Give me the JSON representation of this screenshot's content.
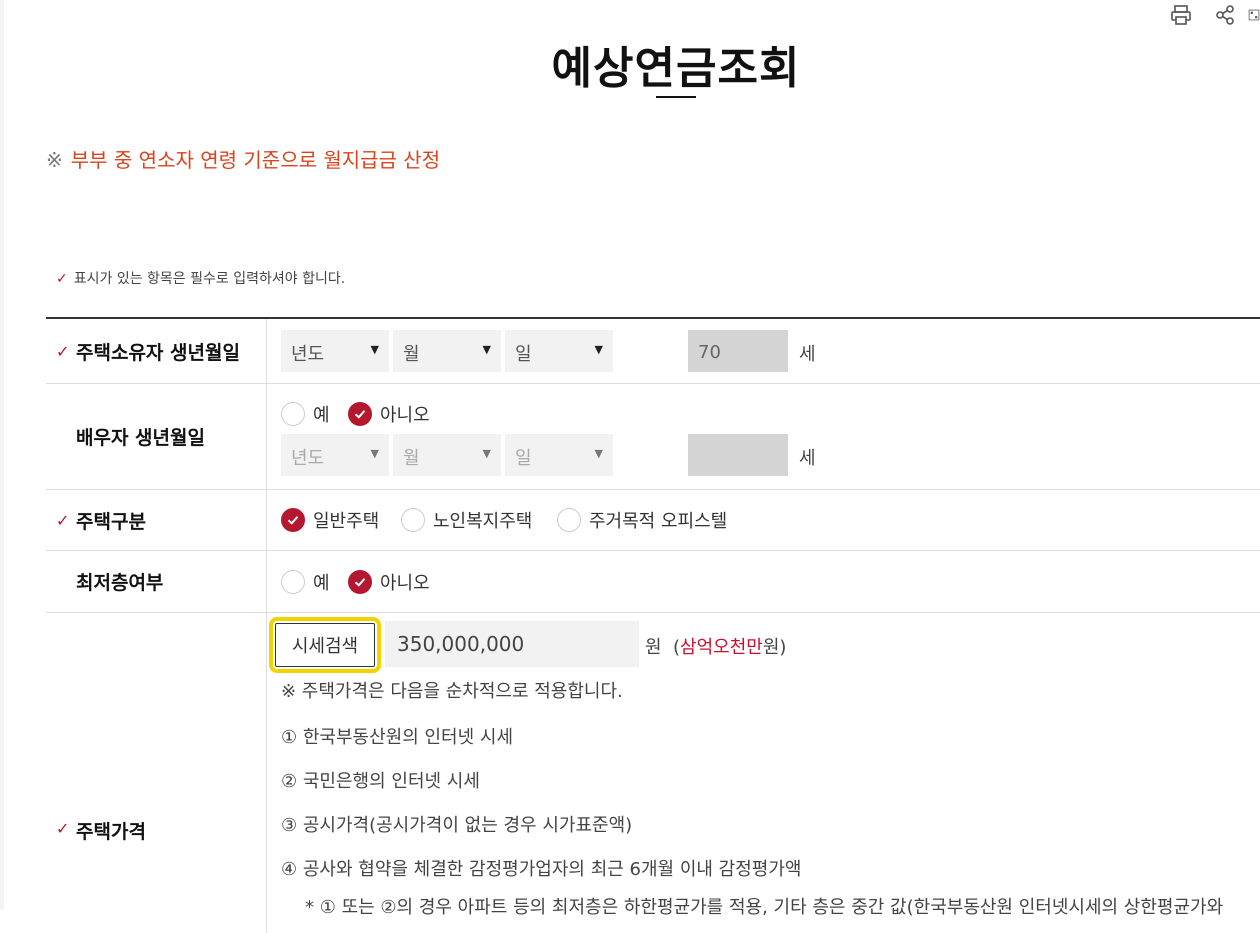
{
  "page": {
    "title": "예상연금조회",
    "notice_mark": "※",
    "notice_text": "부부 중 연소자 연령 기준으로 월지급금 산정",
    "required_text": "표시가 있는 항목은 필수로 입력하셔야 합니다."
  },
  "toolbar": {
    "print_icon": "printer-icon",
    "share_icon": "share-icon",
    "third_icon": "qr-icon"
  },
  "owner_birth": {
    "label": "주택소유자 생년월일",
    "year": "년도",
    "month": "월",
    "day": "일",
    "age": "70",
    "age_unit": "세"
  },
  "spouse_birth": {
    "label": "배우자 생년월일",
    "yes": "예",
    "no": "아니오",
    "selected": "아니오",
    "year": "년도",
    "month": "월",
    "day": "일",
    "age": "",
    "age_unit": "세"
  },
  "house_type": {
    "label": "주택구분",
    "options": [
      "일반주택",
      "노인복지주택",
      "주거목적 오피스텔"
    ],
    "selected": "일반주택"
  },
  "lowest_floor": {
    "label": "최저층여부",
    "yes": "예",
    "no": "아니오",
    "selected": "아니오"
  },
  "house_price": {
    "label": "주택가격",
    "search_button": "시세검색",
    "value": "350,000,000",
    "unit": "원",
    "korean_prefix": "(",
    "korean_amount": "삼억오천만",
    "korean_suffix": "원)",
    "note": "※ 주택가격은 다음을 순차적으로 적용합니다.",
    "rules": [
      "① 한국부동산원의 인터넷 시세",
      "② 국민은행의 인터넷 시세",
      "③ 공시가격(공시가격이 없는 경우 시가표준액)",
      "④ 공사와 협약을 체결한 감정평가업자의 최근 6개월 이내 감정평가액"
    ],
    "footnote": "* ① 또는 ②의 경우 아파트 등의 최저층은 하한평균가를 적용, 기타 층은 중간 값(한국부동산원 인터넷시세의 상한평균가와"
  },
  "colors": {
    "accent": "#b5172f",
    "notice": "#d9431e",
    "highlight": "#f2d300"
  }
}
